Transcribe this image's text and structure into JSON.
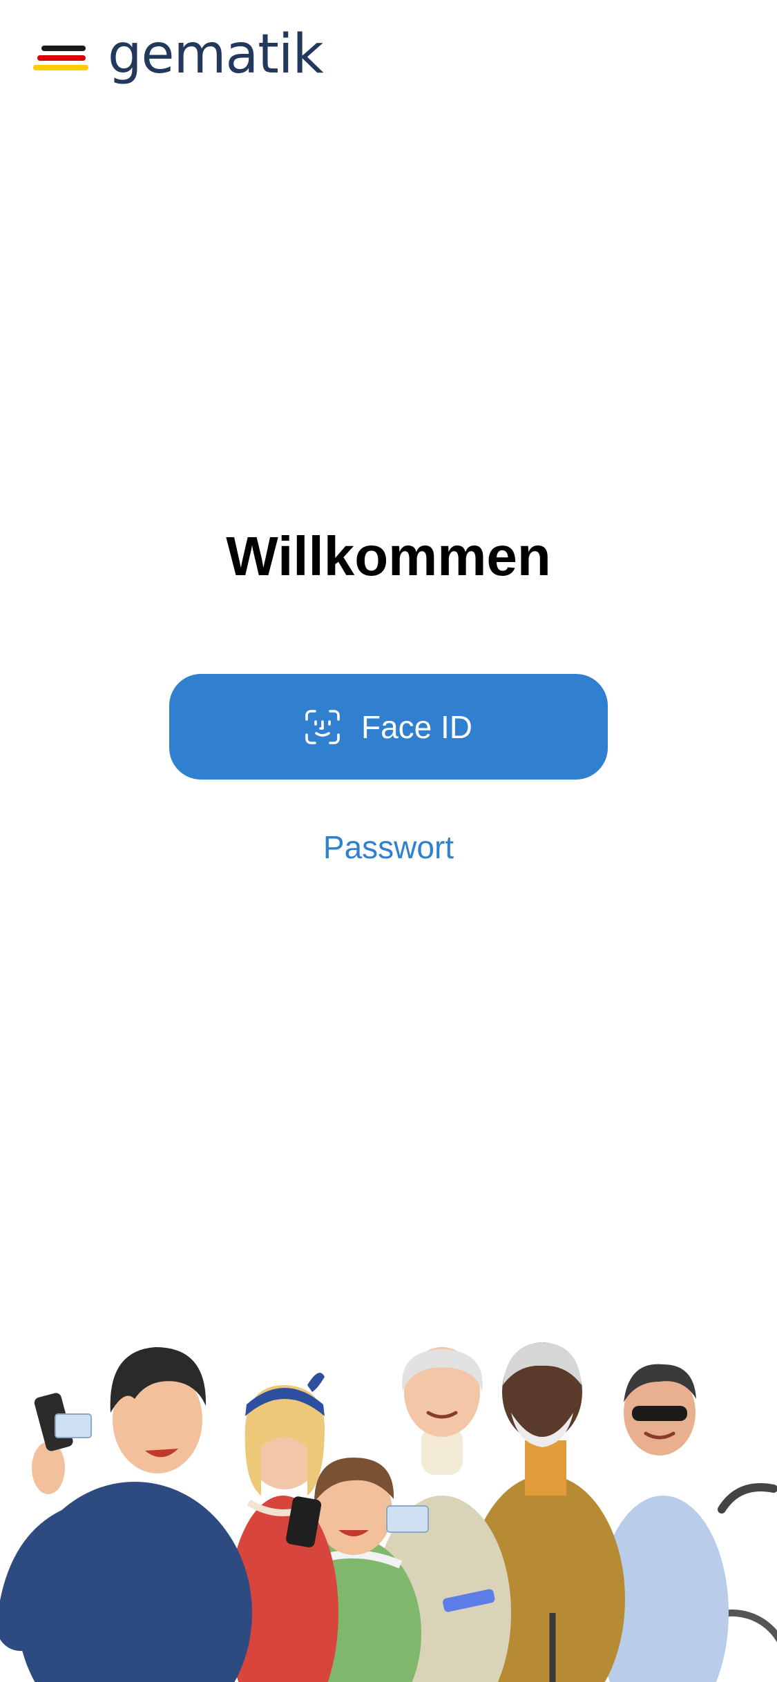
{
  "header": {
    "logo_text": "gematik",
    "logo_icon": "gematik-flag-stripes-logo",
    "logo_colors": {
      "stripe_black": "#1a1a1a",
      "stripe_red": "#dd0000",
      "stripe_gold": "#ffcc00",
      "wordmark": "#22385d"
    }
  },
  "main": {
    "title": "Willkommen",
    "face_id_button": {
      "label": "Face ID",
      "icon": "face-id-icon"
    },
    "password_link": {
      "label": "Passwort"
    }
  },
  "illustration": {
    "icon": "people-group-illustration"
  },
  "colors": {
    "accent": "#3180d0",
    "background": "#ffffff",
    "title_text": "#000000"
  }
}
